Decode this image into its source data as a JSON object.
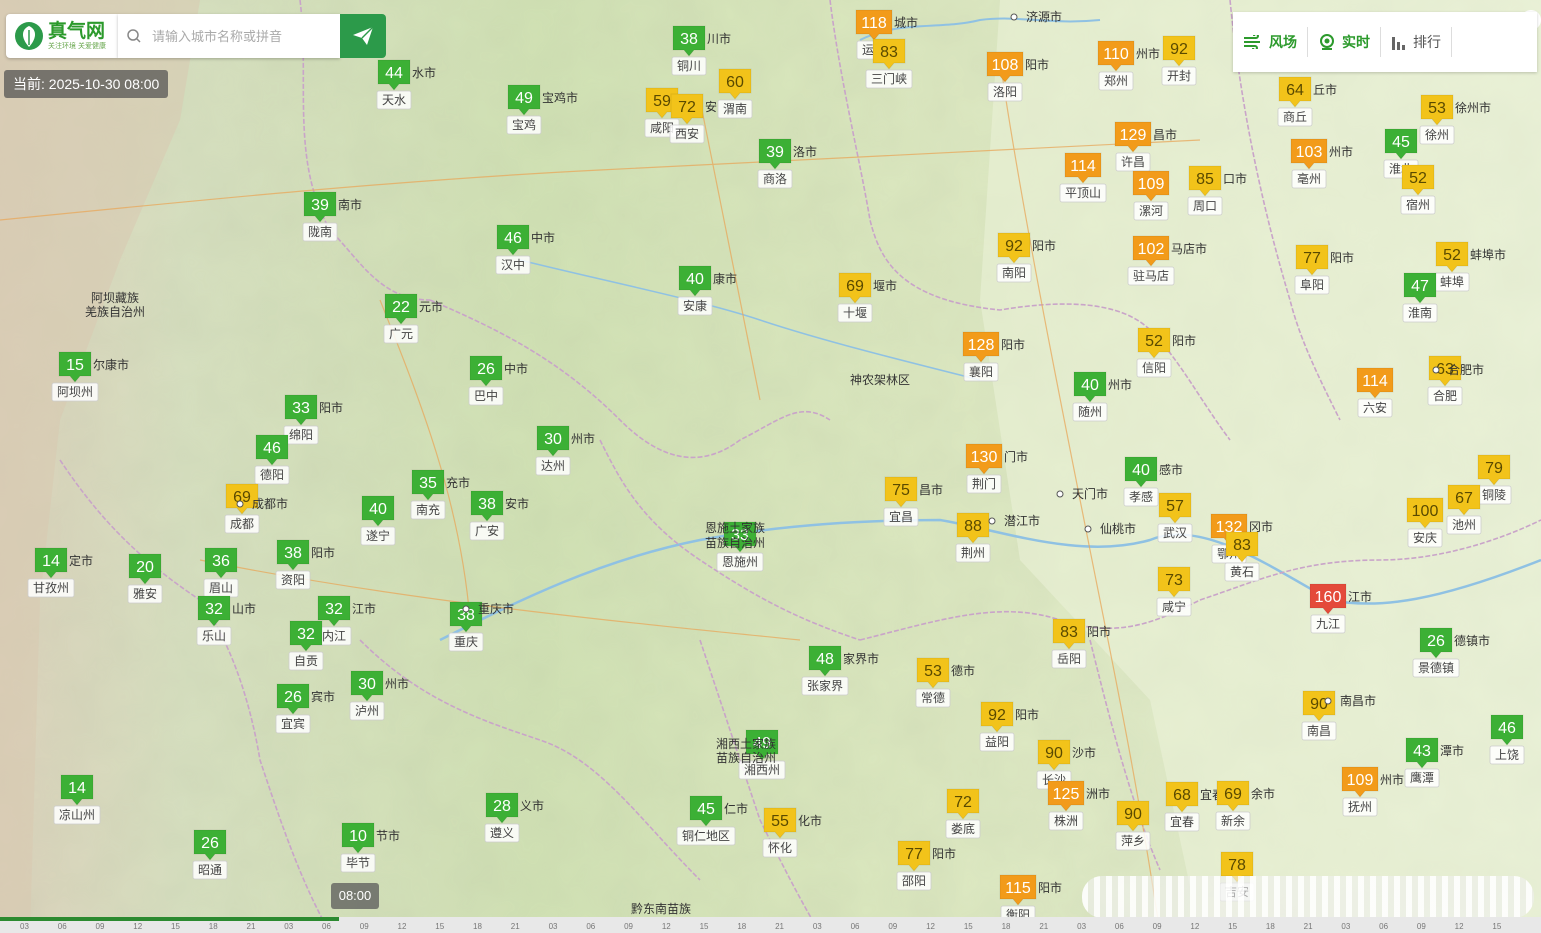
{
  "header": {
    "logo_name": "真气网",
    "logo_slogan": "关注环境 关爱健康",
    "search_placeholder": "请输入城市名称或拼音",
    "time_label": "当前: 2025-10-30 08:00"
  },
  "toolbar": {
    "wind_label": "风场",
    "realtime_label": "实时",
    "rank_label": "排行"
  },
  "timeline": {
    "current_time": "08:00",
    "ticks": [
      "03",
      "06",
      "09",
      "12",
      "15",
      "18",
      "21",
      "03",
      "06",
      "09",
      "12",
      "15",
      "18",
      "21",
      "03",
      "06",
      "09",
      "12",
      "15",
      "18",
      "21",
      "03",
      "06",
      "09",
      "12",
      "15",
      "18",
      "21",
      "03",
      "06",
      "09",
      "12",
      "15",
      "18",
      "21",
      "03",
      "06",
      "09",
      "12",
      "15"
    ],
    "progress": 0.22
  },
  "colors": {
    "good": "#3cb035",
    "moderate": "#f2c31a",
    "unhealthy_sensitive": "#f29b1a",
    "unhealthy": "#e44a3a",
    "brand": "#2c9a4a"
  },
  "map": {
    "region_labels": [
      {
        "text": "阿坝藏族"
      },
      {
        "text": "羌族自治州"
      },
      {
        "text": "神农架林区"
      },
      {
        "text": "恩施土家族"
      },
      {
        "text": "苗族自治州"
      },
      {
        "text": "湘西土家族"
      },
      {
        "text": "苗族自治州"
      },
      {
        "text": "黔东南苗族"
      }
    ],
    "place_labels": [
      {
        "text": "济源市"
      },
      {
        "text": "天门市"
      },
      {
        "text": "仙桃市"
      },
      {
        "text": "潜江市"
      },
      {
        "text": "重庆市"
      },
      {
        "text": "成都市"
      },
      {
        "text": "合肥市"
      },
      {
        "text": "南昌市"
      }
    ],
    "stations": [
      {
        "aqi": 38,
        "name": "铜川",
        "suffix": "川市"
      },
      {
        "aqi": 118,
        "name": "运城",
        "suffix": "城市"
      },
      {
        "aqi": 83,
        "name": "三门峡",
        "suffix": ""
      },
      {
        "aqi": 44,
        "name": "天水",
        "suffix": "水市"
      },
      {
        "aqi": 49,
        "name": "宝鸡",
        "suffix": "宝鸡市"
      },
      {
        "aqi": 60,
        "name": "渭南",
        "suffix": ""
      },
      {
        "aqi": 59,
        "name": "咸阳",
        "suffix": ""
      },
      {
        "aqi": 72,
        "name": "西安",
        "suffix": "安"
      },
      {
        "aqi": 108,
        "name": "洛阳",
        "suffix": "阳市"
      },
      {
        "aqi": 110,
        "name": "郑州",
        "suffix": "州市"
      },
      {
        "aqi": 92,
        "name": "开封",
        "suffix": ""
      },
      {
        "aqi": 64,
        "name": "商丘",
        "suffix": "丘市"
      },
      {
        "aqi": 53,
        "name": "徐州",
        "suffix": "徐州市"
      },
      {
        "aqi": 39,
        "name": "商洛",
        "suffix": "洛市"
      },
      {
        "aqi": 129,
        "name": "许昌",
        "suffix": "昌市"
      },
      {
        "aqi": 114,
        "name": "平顶山",
        "suffix": ""
      },
      {
        "aqi": 109,
        "name": "漯河",
        "suffix": ""
      },
      {
        "aqi": 85,
        "name": "周口",
        "suffix": "口市"
      },
      {
        "aqi": 103,
        "name": "亳州",
        "suffix": "州市"
      },
      {
        "aqi": 45,
        "name": "淮北",
        "suffix": ""
      },
      {
        "aqi": 52,
        "name": "宿州",
        "suffix": ""
      },
      {
        "aqi": 39,
        "name": "陇南",
        "suffix": "南市"
      },
      {
        "aqi": 46,
        "name": "汉中",
        "suffix": "中市"
      },
      {
        "aqi": 92,
        "name": "南阳",
        "suffix": "阳市"
      },
      {
        "aqi": 102,
        "name": "驻马店",
        "suffix": "马店市"
      },
      {
        "aqi": 77,
        "name": "阜阳",
        "suffix": "阳市"
      },
      {
        "aqi": 52,
        "name": "蚌埠",
        "suffix": "蚌埠市"
      },
      {
        "aqi": 40,
        "name": "安康",
        "suffix": "康市"
      },
      {
        "aqi": 69,
        "name": "十堰",
        "suffix": "堰市"
      },
      {
        "aqi": 22,
        "name": "广元",
        "suffix": "元市"
      },
      {
        "aqi": 47,
        "name": "淮南",
        "suffix": ""
      },
      {
        "aqi": 15,
        "name": "阿坝州",
        "suffix": "尔康市"
      },
      {
        "aqi": 26,
        "name": "巴中",
        "suffix": "中市"
      },
      {
        "aqi": 128,
        "name": "襄阳",
        "suffix": "阳市"
      },
      {
        "aqi": 52,
        "name": "信阳",
        "suffix": "阳市"
      },
      {
        "aqi": 114,
        "name": "六安",
        "suffix": ""
      },
      {
        "aqi": 63,
        "name": "合肥",
        "suffix": ""
      },
      {
        "aqi": 33,
        "name": "绵阳",
        "suffix": "阳市"
      },
      {
        "aqi": 40,
        "name": "随州",
        "suffix": "州市"
      },
      {
        "aqi": 46,
        "name": "德阳",
        "suffix": ""
      },
      {
        "aqi": 30,
        "name": "达州",
        "suffix": "州市"
      },
      {
        "aqi": 130,
        "name": "荆门",
        "suffix": "门市"
      },
      {
        "aqi": 40,
        "name": "孝感",
        "suffix": "感市"
      },
      {
        "aqi": 79,
        "name": "铜陵",
        "suffix": ""
      },
      {
        "aqi": 69,
        "name": "成都",
        "suffix": ""
      },
      {
        "aqi": 35,
        "name": "南充",
        "suffix": "充市"
      },
      {
        "aqi": 75,
        "name": "宜昌",
        "suffix": "昌市"
      },
      {
        "aqi": 67,
        "name": "池州",
        "suffix": ""
      },
      {
        "aqi": 40,
        "name": "遂宁",
        "suffix": ""
      },
      {
        "aqi": 38,
        "name": "广安",
        "suffix": "安市"
      },
      {
        "aqi": 57,
        "name": "武汉",
        "suffix": ""
      },
      {
        "aqi": 132,
        "name": "鄂州",
        "suffix": "冈市"
      },
      {
        "aqi": 100,
        "name": "安庆",
        "suffix": ""
      },
      {
        "aqi": 33,
        "name": "恩施州",
        "suffix": ""
      },
      {
        "aqi": 88,
        "name": "荆州",
        "suffix": ""
      },
      {
        "aqi": 83,
        "name": "黄石",
        "suffix": ""
      },
      {
        "aqi": 14,
        "name": "甘孜州",
        "suffix": "定市"
      },
      {
        "aqi": 20,
        "name": "雅安",
        "suffix": ""
      },
      {
        "aqi": 36,
        "name": "眉山",
        "suffix": ""
      },
      {
        "aqi": 38,
        "name": "资阳",
        "suffix": "阳市"
      },
      {
        "aqi": 73,
        "name": "咸宁",
        "suffix": ""
      },
      {
        "aqi": 160,
        "name": "九江",
        "suffix": "江市"
      },
      {
        "aqi": 32,
        "name": "乐山",
        "suffix": "山市"
      },
      {
        "aqi": 32,
        "name": "内江",
        "suffix": "江市"
      },
      {
        "aqi": 32,
        "name": "自贡",
        "suffix": ""
      },
      {
        "aqi": 38,
        "name": "重庆",
        "suffix": ""
      },
      {
        "aqi": 83,
        "name": "岳阳",
        "suffix": "阳市"
      },
      {
        "aqi": 26,
        "name": "景德镇",
        "suffix": "德镇市"
      },
      {
        "aqi": 48,
        "name": "张家界",
        "suffix": "家界市"
      },
      {
        "aqi": 53,
        "name": "常德",
        "suffix": "德市"
      },
      {
        "aqi": 26,
        "name": "宜宾",
        "suffix": "宾市"
      },
      {
        "aqi": 30,
        "name": "泸州",
        "suffix": "州市"
      },
      {
        "aqi": 92,
        "name": "益阳",
        "suffix": "阳市"
      },
      {
        "aqi": 90,
        "name": "南昌",
        "suffix": ""
      },
      {
        "aqi": 46,
        "name": "上饶",
        "suffix": ""
      },
      {
        "aqi": 49,
        "name": "湘西州",
        "suffix": ""
      },
      {
        "aqi": 90,
        "name": "长沙",
        "suffix": "沙市"
      },
      {
        "aqi": 43,
        "name": "鹰潭",
        "suffix": "潭市"
      },
      {
        "aqi": 14,
        "name": "凉山州",
        "suffix": ""
      },
      {
        "aqi": 28,
        "name": "遵义",
        "suffix": "义市"
      },
      {
        "aqi": 45,
        "name": "铜仁地区",
        "suffix": "仁市"
      },
      {
        "aqi": 72,
        "name": "娄底",
        "suffix": ""
      },
      {
        "aqi": 125,
        "name": "株洲",
        "suffix": "洲市"
      },
      {
        "aqi": 68,
        "name": "宜春",
        "suffix": "宜春市"
      },
      {
        "aqi": 69,
        "name": "新余",
        "suffix": "余市"
      },
      {
        "aqi": 109,
        "name": "抚州",
        "suffix": "州市"
      },
      {
        "aqi": 55,
        "name": "怀化",
        "suffix": "化市"
      },
      {
        "aqi": 90,
        "name": "萍乡",
        "suffix": ""
      },
      {
        "aqi": 26,
        "name": "昭通",
        "suffix": ""
      },
      {
        "aqi": 10,
        "name": "毕节",
        "suffix": "节市"
      },
      {
        "aqi": 77,
        "name": "邵阳",
        "suffix": "阳市"
      },
      {
        "aqi": 115,
        "name": "衡阳",
        "suffix": "阳市"
      },
      {
        "aqi": 78,
        "name": "吉安",
        "suffix": ""
      }
    ]
  }
}
